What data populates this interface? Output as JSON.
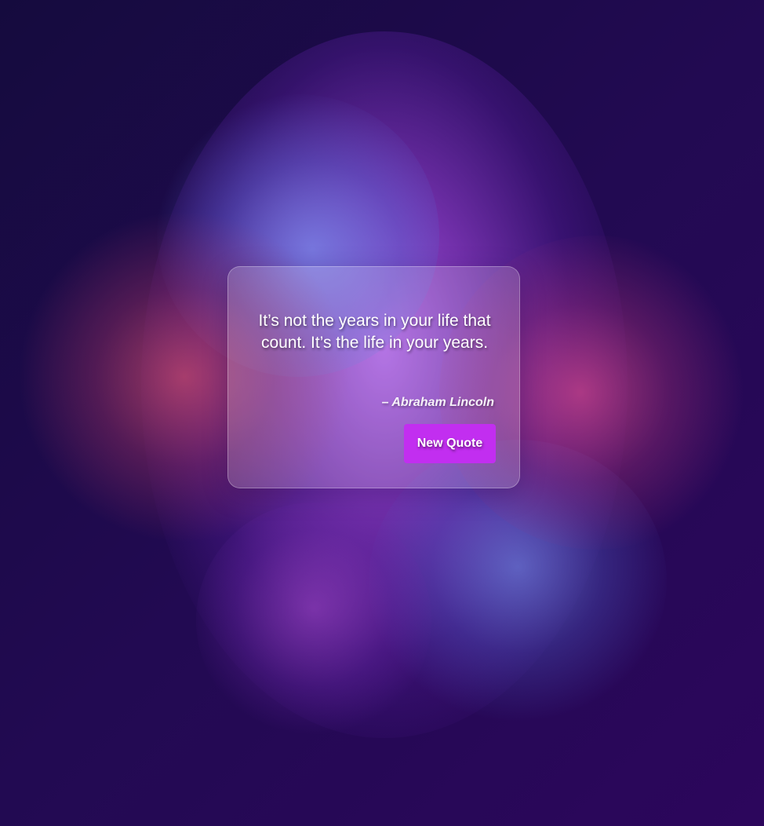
{
  "quote_card": {
    "quote_text": "It’s not the years in your life that count. It’s the life in your years.",
    "author": "– Abraham Lincoln",
    "new_quote_button_label": "New Quote"
  },
  "colors": {
    "button_accent": "#c22ef0",
    "background_dark": "#1f0a47",
    "text": "#ffffff"
  }
}
